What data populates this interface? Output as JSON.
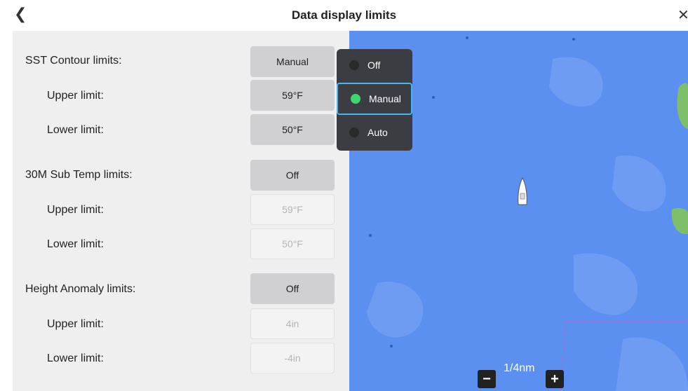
{
  "header": {
    "title": "Data display limits",
    "back_icon": "chevron-left-icon",
    "close_icon": "close-icon"
  },
  "settings": {
    "rows": [
      {
        "label": "SST Contour limits:",
        "value": "Manual"
      },
      {
        "label": "Upper limit:",
        "value": "59°F"
      },
      {
        "label": "Lower limit:",
        "value": "50°F"
      },
      {
        "label": "30M Sub Temp limits:",
        "value": "Off"
      },
      {
        "label": "Upper limit:",
        "value": "59°F"
      },
      {
        "label": "Lower limit:",
        "value": "50°F"
      },
      {
        "label": "Height Anomaly limits:",
        "value": "Off"
      },
      {
        "label": "Upper limit:",
        "value": "4in"
      },
      {
        "label": "Lower limit:",
        "value": "-4in"
      }
    ]
  },
  "dropdown": {
    "options": [
      "Off",
      "Manual",
      "Auto"
    ],
    "selected": "Manual",
    "selected_color": "#3ed66f"
  },
  "map": {
    "scale_label": "1/4nm",
    "zoom_out": "−",
    "zoom_in": "+",
    "water_color": "#5b8ff0"
  }
}
